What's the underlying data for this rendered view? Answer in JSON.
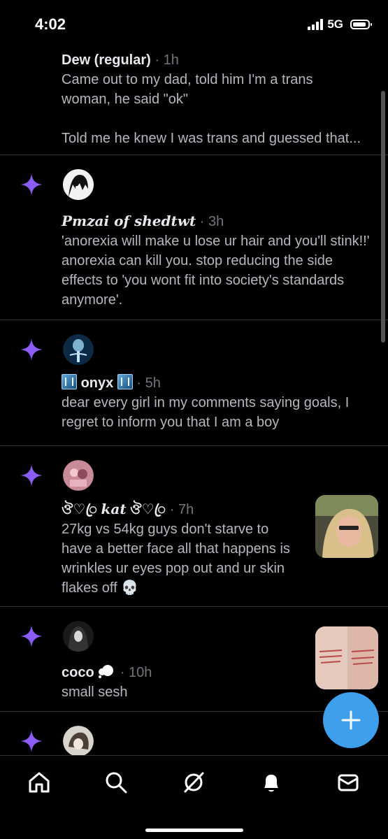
{
  "status_bar": {
    "time": "4:02",
    "network": "5G"
  },
  "feed": {
    "posts": [
      {
        "name": "Dew (regular)",
        "separator": "·",
        "time": "1h",
        "text_1": "Came out to my dad, told him I'm a trans woman, he said \"ok\"",
        "text_2": "Told me he knew I was trans and guessed that..."
      },
      {
        "name": "᯽𝓟𝓶𝔃𝓪𝓲 𝓸𝓯 𝓼𝓱𝓮𝓭𝓽𝔀𝓽᯽",
        "name_plain": "Pmzai of shedtwt",
        "separator": "·",
        "time": "3h",
        "text": "'anorexia will make u lose ur hair and you'll stink!!' anorexia can kill you. stop reducing the side effects to 'you wont fit into society's standards anymore'."
      },
      {
        "name": "onyx",
        "separator": "·",
        "time": "5h",
        "text": "dear every girl in my comments saying goals, I regret to inform you that I am a boy"
      },
      {
        "name_prefix": "ঔ♡ꦿ",
        "name": "kat",
        "name_suffix": "ঔ♡ꦿ",
        "separator": "·",
        "time": "7h",
        "text": "27kg vs 54kg guys don't starve to have a better face all that happens is wrinkles ur eyes pop out and ur skin flakes off 💀"
      },
      {
        "name": "coco",
        "separator": "·",
        "time": "10h",
        "text": "small sesh"
      }
    ]
  },
  "icons": {
    "sparkle": "sparkle-icon",
    "compose": "plus-icon",
    "nav": [
      "home-icon",
      "search-icon",
      "grok-icon",
      "bell-icon",
      "mail-icon"
    ]
  },
  "colors": {
    "accent": "#3e9fec",
    "sparkle": "#8b5cf6",
    "background": "#000000",
    "muted": "#71767b"
  }
}
